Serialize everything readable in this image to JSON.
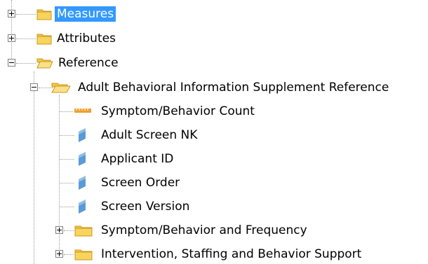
{
  "tree": {
    "nodes": [
      {
        "label": "Measures",
        "icon": "folder-closed-icon",
        "state": "collapsed",
        "selected": true
      },
      {
        "label": "Attributes",
        "icon": "folder-closed-icon",
        "state": "collapsed"
      },
      {
        "label": "Reference",
        "icon": "folder-open-icon",
        "state": "expanded"
      },
      {
        "label": "Adult Behavioral Information Supplement Reference",
        "icon": "folder-open-icon",
        "state": "expanded"
      },
      {
        "label": "Symptom/Behavior Count",
        "icon": "measure-ruler-icon"
      },
      {
        "label": "Adult Screen NK",
        "icon": "attribute-icon"
      },
      {
        "label": "Applicant ID",
        "icon": "attribute-icon"
      },
      {
        "label": "Screen Order",
        "icon": "attribute-icon"
      },
      {
        "label": "Screen Version",
        "icon": "attribute-icon"
      },
      {
        "label": "Symptom/Behavior and Frequency",
        "icon": "folder-closed-icon",
        "state": "collapsed"
      },
      {
        "label": "Intervention, Staffing and Behavior Support",
        "icon": "folder-closed-icon",
        "state": "collapsed"
      }
    ]
  },
  "colors": {
    "selection": "#3399ff",
    "folder": "#f5c542",
    "attribute": "#5b9bd5",
    "measure": "#f0a030"
  }
}
